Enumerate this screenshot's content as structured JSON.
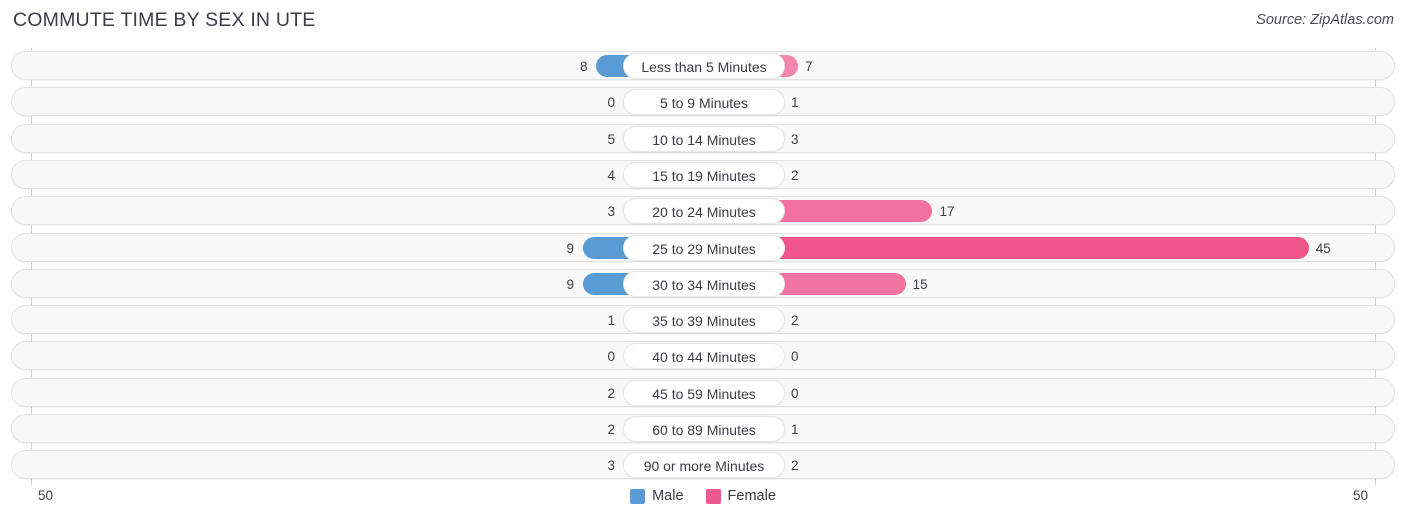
{
  "header": {
    "title": "COMMUTE TIME BY SEX IN UTE",
    "source": "Source: ZipAtlas.com"
  },
  "legend": {
    "items": [
      {
        "label": "Male",
        "color": "#5B9BD5"
      },
      {
        "label": "Female",
        "color": "#EC5A92"
      }
    ]
  },
  "axis": {
    "left_tick": "50",
    "right_tick": "50",
    "max": 50
  },
  "colors": {
    "male_strong": "#5B9BD5",
    "male_light": "#AFCBEC",
    "female_strong": "#F2558C",
    "female_light": "#F295B6",
    "row_bg": "#F8F8F8",
    "row_border": "#E2E2E4",
    "text": "#40404A"
  },
  "chart_data": {
    "type": "bar",
    "title": "COMMUTE TIME BY SEX IN UTE",
    "subtitle": "Source: ZipAtlas.com",
    "orientation": "horizontal-diverging",
    "xlabel": "",
    "ylabel": "",
    "xlim": [
      50,
      50
    ],
    "grid": false,
    "legend_position": "bottom-center",
    "categories": [
      "Less than 5 Minutes",
      "5 to 9 Minutes",
      "10 to 14 Minutes",
      "15 to 19 Minutes",
      "20 to 24 Minutes",
      "25 to 29 Minutes",
      "30 to 34 Minutes",
      "35 to 39 Minutes",
      "40 to 44 Minutes",
      "45 to 59 Minutes",
      "60 to 89 Minutes",
      "90 or more Minutes"
    ],
    "series": [
      {
        "name": "Male",
        "values": [
          8,
          0,
          5,
          4,
          3,
          9,
          9,
          1,
          0,
          2,
          2,
          3
        ]
      },
      {
        "name": "Female",
        "values": [
          7,
          1,
          3,
          2,
          17,
          45,
          15,
          2,
          0,
          0,
          1,
          2
        ]
      }
    ],
    "rows": [
      {
        "category": "Less than 5 Minutes",
        "male": 8,
        "female": 7,
        "male_label": "8",
        "female_label": "7"
      },
      {
        "category": "5 to 9 Minutes",
        "male": 0,
        "female": 1,
        "male_label": "0",
        "female_label": "1"
      },
      {
        "category": "10 to 14 Minutes",
        "male": 5,
        "female": 3,
        "male_label": "5",
        "female_label": "3"
      },
      {
        "category": "15 to 19 Minutes",
        "male": 4,
        "female": 2,
        "male_label": "4",
        "female_label": "2"
      },
      {
        "category": "20 to 24 Minutes",
        "male": 3,
        "female": 17,
        "male_label": "3",
        "female_label": "17"
      },
      {
        "category": "25 to 29 Minutes",
        "male": 9,
        "female": 45,
        "male_label": "9",
        "female_label": "45"
      },
      {
        "category": "30 to 34 Minutes",
        "male": 9,
        "female": 15,
        "male_label": "9",
        "female_label": "15"
      },
      {
        "category": "35 to 39 Minutes",
        "male": 1,
        "female": 2,
        "male_label": "1",
        "female_label": "2"
      },
      {
        "category": "40 to 44 Minutes",
        "male": 0,
        "female": 0,
        "male_label": "0",
        "female_label": "0"
      },
      {
        "category": "45 to 59 Minutes",
        "male": 2,
        "female": 0,
        "male_label": "2",
        "female_label": "0"
      },
      {
        "category": "60 to 89 Minutes",
        "male": 2,
        "female": 1,
        "male_label": "2",
        "female_label": "1"
      },
      {
        "category": "90 or more Minutes",
        "male": 3,
        "female": 2,
        "male_label": "3",
        "female_label": "2"
      }
    ]
  }
}
